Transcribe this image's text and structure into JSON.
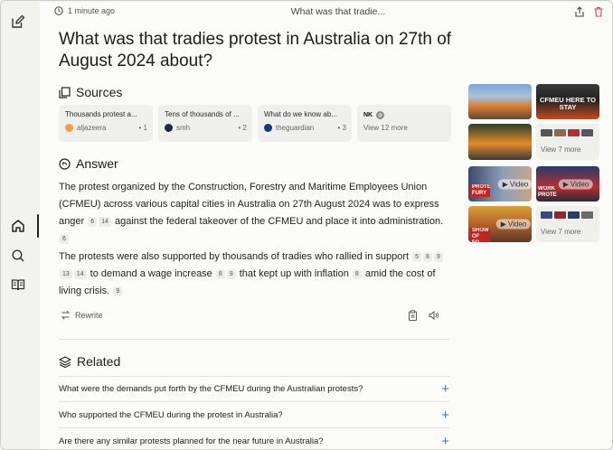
{
  "topbar": {
    "time": "1 minute ago",
    "title": "What was that tradie..."
  },
  "question": "What was that tradies protest in Australia on 27th of August 2024 about?",
  "sources": {
    "heading": "Sources",
    "items": [
      {
        "title": "Thousands protest a...",
        "site": "aljazeera",
        "num": "1",
        "color": "#f2a03d"
      },
      {
        "title": "Tens of thousands of ...",
        "site": "smh",
        "num": "2",
        "color": "#1d2a44"
      },
      {
        "title": "What do we know ab...",
        "site": "theguardian",
        "num": "3",
        "color": "#0b3e7a"
      }
    ],
    "more_label": "View 12 more",
    "more_logo": "NK"
  },
  "answer": {
    "heading": "Answer",
    "p1_a": "The protest organized by the Construction, Forestry and Maritime Employees Union (CFMEU) across various capital cities in Australia on 27th August 2024 was to express anger",
    "p1_c1": "6",
    "p1_c2": "14",
    "p1_b": "against the federal takeover of the CFMEU and place it into administration.",
    "p1_c3": "6",
    "p2_a": "The protests were also supported by thousands of tradies who rallied in support",
    "p2_c1": "5",
    "p2_c2": "8",
    "p2_c3": "9",
    "p2_c4": "13",
    "p2_c5": "14",
    "p2_b": "to demand a wage increase",
    "p2_c6": "8",
    "p2_c7": "9",
    "p2_c": "that kept up with inflation",
    "p2_c8": "8",
    "p2_d": "amid the cost of living crisis.",
    "p2_c9": "9"
  },
  "actions": {
    "rewrite": "Rewrite"
  },
  "related": {
    "heading": "Related",
    "items": [
      "What were the demands put forth by the CFMEU during the Australian protests?",
      "Who supported the CFMEU during the protest in Australia?",
      "Are there any similar protests planned for the near future in Australia?"
    ]
  },
  "media": {
    "images_more": "View 7 more",
    "video_label": "Video",
    "videos_more": "View 7 more",
    "thumb_text_cfmeu": "CFMEU HERE TO STAY",
    "thumb_text_protest": "PROTEST FURY",
    "thumb_text_work": "WORK PROTE",
    "thumb_text_show": "SHOW OF FO"
  },
  "colors": {
    "accent": "#3b7ad8",
    "delete": "#e0453a"
  }
}
